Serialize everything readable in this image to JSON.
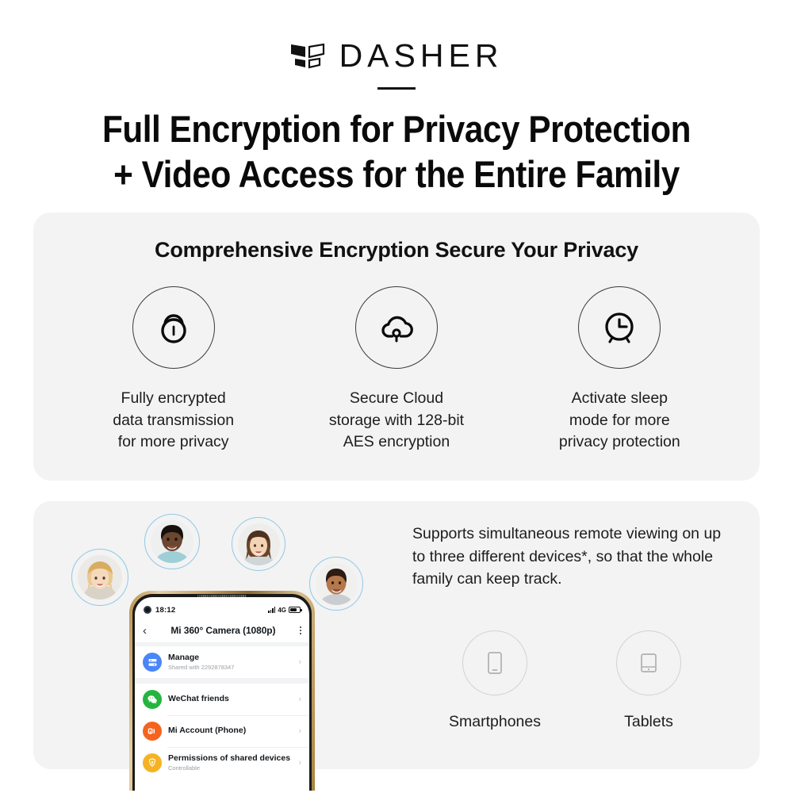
{
  "brand": {
    "name": "DASHER",
    "logo_icon": "dasher-chevron-logo"
  },
  "headline": {
    "line1": "Full Encryption for Privacy Protection",
    "line2": "+ Video Access for the Entire Family"
  },
  "encryption_card": {
    "title": "Comprehensive Encryption Secure Your Privacy",
    "features": [
      {
        "icon": "padlock-icon",
        "caption": "Fully encrypted\ndata transmission\nfor more privacy"
      },
      {
        "icon": "cloud-key-icon",
        "caption": "Secure Cloud\nstorage with 128-bit\nAES encryption"
      },
      {
        "icon": "alarm-clock-icon",
        "caption": "Activate sleep\nmode for more\nprivacy protection"
      }
    ]
  },
  "family_card": {
    "body": "Supports simultaneous remote viewing on up to three different devices*, so that the whole family can keep track.",
    "devices": [
      {
        "icon": "smartphone-icon",
        "label": "Smartphones"
      },
      {
        "icon": "tablet-icon",
        "label": "Tablets"
      }
    ],
    "avatars": [
      {
        "name": "avatar-woman-blonde"
      },
      {
        "name": "avatar-man-dark"
      },
      {
        "name": "avatar-woman-brunette"
      },
      {
        "name": "avatar-young-man"
      }
    ]
  },
  "phone": {
    "statusbar": {
      "time": "18:12",
      "network": "4G"
    },
    "app_header": {
      "title": "Mi 360° Camera (1080p)",
      "back_icon": "chevron-left-icon",
      "menu_icon": "kebab-menu-icon"
    },
    "rows": [
      {
        "title": "Manage",
        "subtitle": "Shared with 2292878347",
        "icon": "manage-icon",
        "color": "#4a86f7"
      },
      {
        "title": "WeChat friends",
        "subtitle": "",
        "icon": "wechat-icon",
        "color": "#25b53e"
      },
      {
        "title": "Mi Account (Phone)",
        "subtitle": "",
        "icon": "mi-account-icon",
        "color": "#f5641e"
      },
      {
        "title": "Permissions of shared devices",
        "subtitle": "Controllable",
        "icon": "shield-permissions-icon",
        "color": "#f5b324"
      }
    ]
  },
  "colors": {
    "card_bg": "#f3f3f3",
    "avatar_ring": "#8fc9e6",
    "text": "#1d1d1d"
  }
}
